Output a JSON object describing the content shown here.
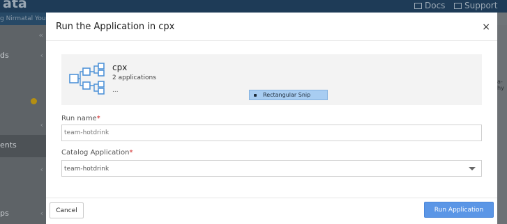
{
  "background": {
    "brand": "ata",
    "top_links": [
      {
        "label": "Docs",
        "icon": "book-icon"
      },
      {
        "label": "Support",
        "icon": "chat-icon"
      }
    ],
    "subbar_text": "g Nirmatal You",
    "sidebar_items": [
      {
        "label": "ds",
        "icon": "chevron-left-icon"
      },
      {
        "label": "ents"
      },
      {
        "label": "ps"
      }
    ],
    "right_panel_text": "a-hy"
  },
  "modal": {
    "title": "Run the Application in cpx",
    "close_label": "×",
    "summary": {
      "name": "cpx",
      "count": "2 applications",
      "more": "...",
      "snip_label": "Rectangular Snip"
    },
    "run_name": {
      "label": "Run name",
      "required_mark": "*",
      "placeholder": "team-hotdrink",
      "value": ""
    },
    "catalog_application": {
      "label": "Catalog Application",
      "required_mark": "*",
      "selected": "team-hotdrink"
    },
    "buttons": {
      "cancel": "Cancel",
      "run": "Run Application"
    }
  },
  "colors": {
    "primary_button": "#5b96e6",
    "required": "#d12424",
    "icon_blue": "#4f93d8",
    "overlay_topbar": "#1e3b57"
  }
}
